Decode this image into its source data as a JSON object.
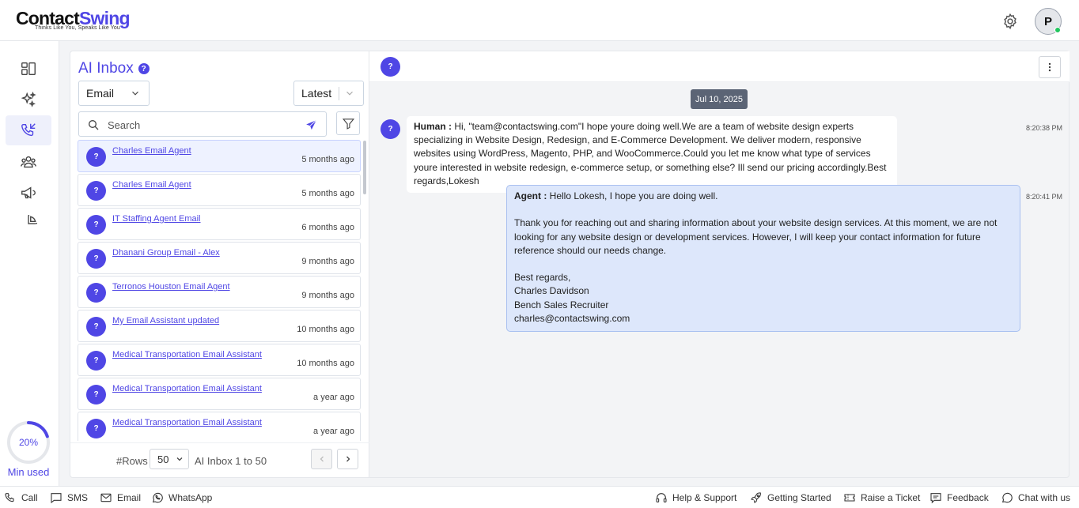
{
  "header": {
    "logo_main_a": "Contact",
    "logo_main_b": "Swing",
    "logo_tagline": "Thinks Like You, Speaks Like You",
    "avatar_initial": "P",
    "icons": [
      "gear-icon",
      "avatar"
    ]
  },
  "nav": {
    "items": [
      {
        "name": "dashboard-icon"
      },
      {
        "name": "sparkles-icon"
      },
      {
        "name": "phone-calls-icon",
        "active": true
      },
      {
        "name": "contacts-icon"
      },
      {
        "name": "megaphone-icon"
      },
      {
        "name": "pie-chart-icon"
      }
    ],
    "usage_percent": "20%",
    "usage_fraction": 0.2,
    "usage_label": "Min used"
  },
  "inbox": {
    "title": "AI Inbox",
    "help": "?",
    "channel_select": "Email",
    "sort_select": "Latest",
    "search_placeholder": "Search",
    "items": [
      {
        "initial": "?",
        "name": "Charles Email Agent",
        "time": "5 months ago",
        "active": true
      },
      {
        "initial": "?",
        "name": "Charles Email Agent",
        "time": "5 months ago"
      },
      {
        "initial": "?",
        "name": "IT Staffing Agent Email",
        "time": "6 months ago"
      },
      {
        "initial": "?",
        "name": "Dhanani Group Email - Alex",
        "time": "9 months ago"
      },
      {
        "initial": "?",
        "name": "Terronos Houston Email Agent",
        "time": "9 months ago"
      },
      {
        "initial": "?",
        "name": "My Email Assistant updated",
        "time": "10 months ago"
      },
      {
        "initial": "?",
        "name": "Medical Transportation Email Assistant",
        "time": "10 months ago"
      },
      {
        "initial": "?",
        "name": "Medical Transportation Email Assistant",
        "time": "a year ago"
      },
      {
        "initial": "?",
        "name": "Medical Transportation Email Assistant",
        "time": "a year ago"
      }
    ],
    "pager": {
      "rows_label": "#Rows",
      "rows_value": "50",
      "range_text": "AI Inbox 1 to 50"
    }
  },
  "conversation": {
    "header_initial": "?",
    "date": "Jul 10, 2025",
    "messages": [
      {
        "role": "human",
        "initial": "?",
        "speaker": "Human :",
        "text": " Hi, \"team@contactswing.com\"I hope youre doing well.We are a team of website design experts specializing in Website Design, Redesign, and E-Commerce Development. We deliver modern, responsive websites using WordPress, Magento, PHP, and WooCommerce.Could you let me know what type of services youre interested in  website redesign, e-commerce setup, or something else? Ill send our pricing accordingly.Best regards,Lokesh",
        "time": "8:20:38 PM"
      },
      {
        "role": "agent",
        "speaker": "Agent :",
        "lines": [
          " Hello Lokesh, I hope you are doing well.",
          "",
          "Thank you for reaching out and sharing information about your website design services. At this moment, we are not looking for any website design or development services. However, I will keep your contact information for future reference should our needs change.",
          "",
          "Best regards,",
          "Charles Davidson",
          "Bench Sales Recruiter",
          "charles@contactswing.com"
        ],
        "time": "8:20:41 PM"
      }
    ]
  },
  "bottombar": {
    "call": "Call",
    "sms": "SMS",
    "email": "Email",
    "whatsapp": "WhatsApp",
    "help": "Help & Support",
    "getting_started": "Getting Started",
    "ticket": "Raise a Ticket",
    "feedback": "Feedback",
    "chat": "Chat with us"
  }
}
